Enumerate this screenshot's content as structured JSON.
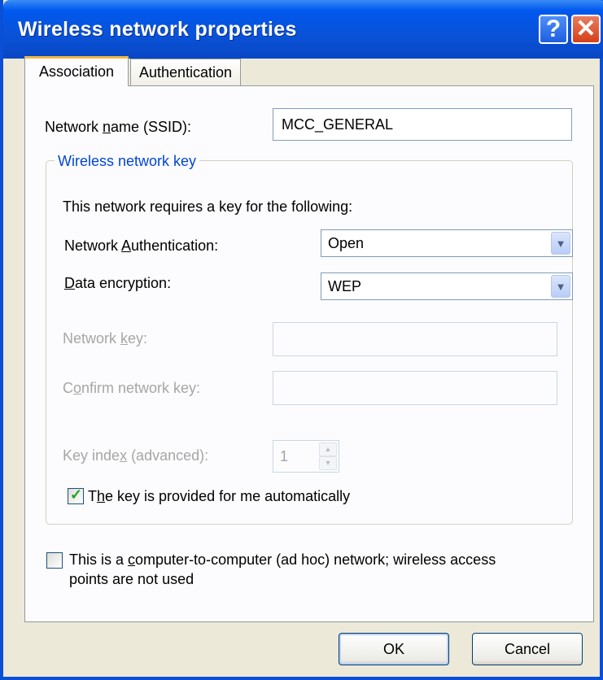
{
  "window": {
    "title": "Wireless network properties",
    "help_glyph": "?",
    "close_glyph": "✕"
  },
  "tabs": [
    {
      "label": "Association",
      "active": true
    },
    {
      "label": "Authentication",
      "active": false
    }
  ],
  "association": {
    "ssid_label_pre": "Network ",
    "ssid_label_ul": "n",
    "ssid_label_post": "ame (SSID):",
    "ssid_value": "MCC_GENERAL",
    "group_label": "Wireless network key",
    "requires_text": "This network requires a key for the following:",
    "auth_label_pre": "Network ",
    "auth_label_ul": "A",
    "auth_label_post": "uthentication:",
    "auth_value": "Open",
    "enc_label_ul": "D",
    "enc_label_post": "ata encryption:",
    "enc_value": "WEP",
    "netkey_label_pre": "Network ",
    "netkey_label_ul": "k",
    "netkey_label_post": "ey:",
    "netkey_value": "",
    "confirm_label_pre": "C",
    "confirm_label_ul": "o",
    "confirm_label_post": "nfirm network key:",
    "confirm_value": "",
    "keyindex_label_pre": "Key inde",
    "keyindex_label_ul": "x",
    "keyindex_label_post": " (advanced):",
    "keyindex_value": "1",
    "auto_key_label_pre": "T",
    "auto_key_label_ul": "h",
    "auto_key_label_post": "e key is provided for me automatically",
    "auto_key_checked": true,
    "adhoc_label_pre": "This is a ",
    "adhoc_label_ul": "c",
    "adhoc_label_post": "omputer-to-computer (ad hoc) network; wireless access",
    "adhoc_label_line2": "points are not used",
    "adhoc_checked": false
  },
  "buttons": {
    "ok": "OK",
    "cancel": "Cancel"
  },
  "colors": {
    "titlebar": "#0058ee",
    "group_label": "#0046d5",
    "disabled_text": "#a6a6a6",
    "check_mark": "#21a121"
  }
}
